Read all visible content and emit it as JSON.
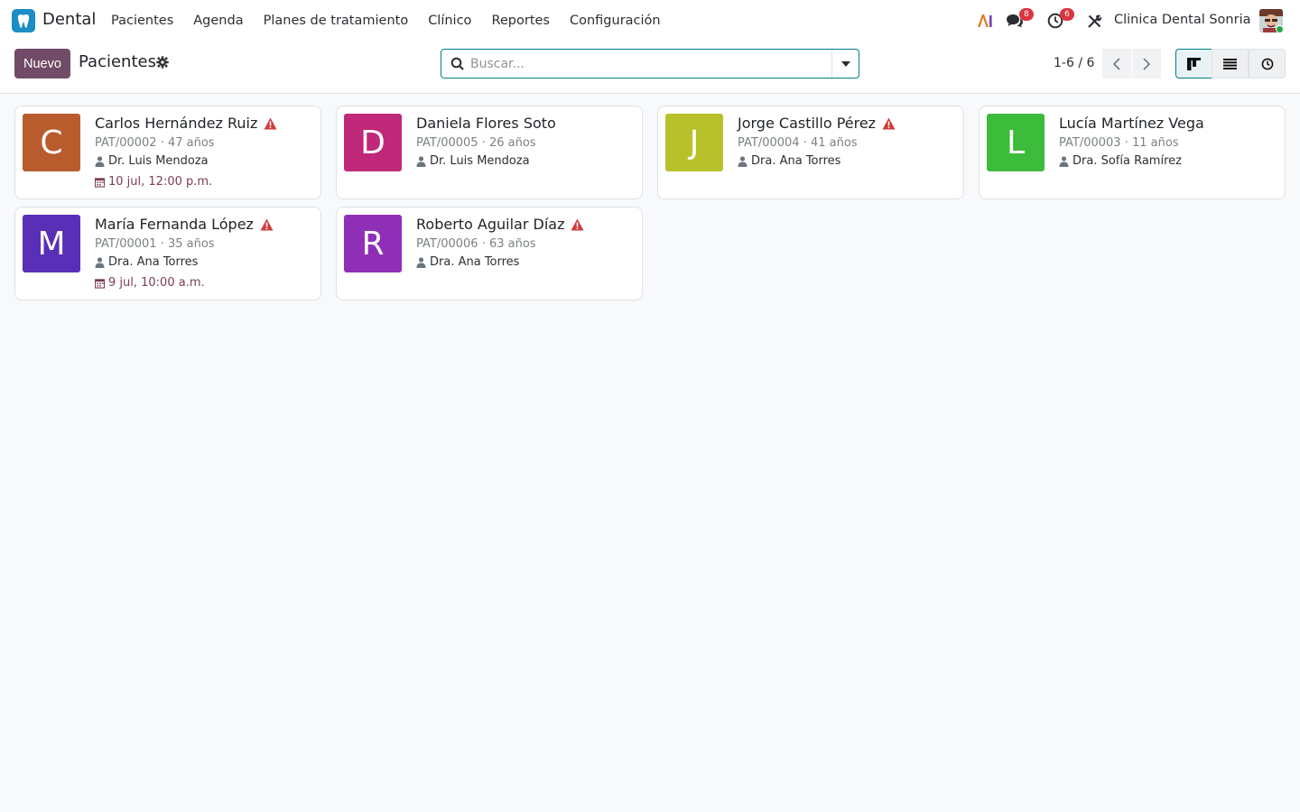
{
  "app": {
    "name": "Dental",
    "brand_color": "#1b8fc4",
    "accent": "#714b67",
    "primary": "#017e84"
  },
  "menu": [
    {
      "label": "Pacientes"
    },
    {
      "label": "Agenda"
    },
    {
      "label": "Planes de tratamiento"
    },
    {
      "label": "Clínico"
    },
    {
      "label": "Reportes"
    },
    {
      "label": "Configuración"
    }
  ],
  "systray": {
    "ai_icon": "ai-icon",
    "messages_count": "8",
    "activities_count": "6",
    "company": "Clinica Dental Sonria"
  },
  "control": {
    "new_label": "Nuevo",
    "title": "Pacientes",
    "search_placeholder": "Buscar...",
    "pager": "1-6 / 6",
    "views": [
      "kanban",
      "list",
      "activity"
    ],
    "active_view": "kanban"
  },
  "patients": [
    {
      "initial": "C",
      "color": "#b85c2e",
      "name": "Carlos Hernández Ruiz",
      "alert": true,
      "sub": "PAT/00002 · 47 años",
      "doctor": "Dr. Luis Mendoza",
      "appointment": "10 jul, 12:00 p.m."
    },
    {
      "initial": "D",
      "color": "#c0287a",
      "name": "Daniela Flores Soto",
      "alert": false,
      "sub": "PAT/00005 · 26 años",
      "doctor": "Dr. Luis Mendoza",
      "appointment": ""
    },
    {
      "initial": "J",
      "color": "#b7c22a",
      "name": "Jorge Castillo Pérez",
      "alert": true,
      "sub": "PAT/00004 · 41 años",
      "doctor": "Dra. Ana Torres",
      "appointment": ""
    },
    {
      "initial": "L",
      "color": "#3dbb3a",
      "name": "Lucía Martínez Vega",
      "alert": false,
      "sub": "PAT/00003 · 11 años",
      "doctor": "Dra. Sofía Ramírez",
      "appointment": ""
    },
    {
      "initial": "M",
      "color": "#5a2fb7",
      "name": "María Fernanda López",
      "alert": true,
      "sub": "PAT/00001 · 35 años",
      "doctor": "Dra. Ana Torres",
      "appointment": "9 jul, 10:00 a.m."
    },
    {
      "initial": "R",
      "color": "#8f2fb7",
      "name": "Roberto Aguilar Díaz",
      "alert": true,
      "sub": "PAT/00006 · 63 años",
      "doctor": "Dra. Ana Torres",
      "appointment": ""
    }
  ]
}
